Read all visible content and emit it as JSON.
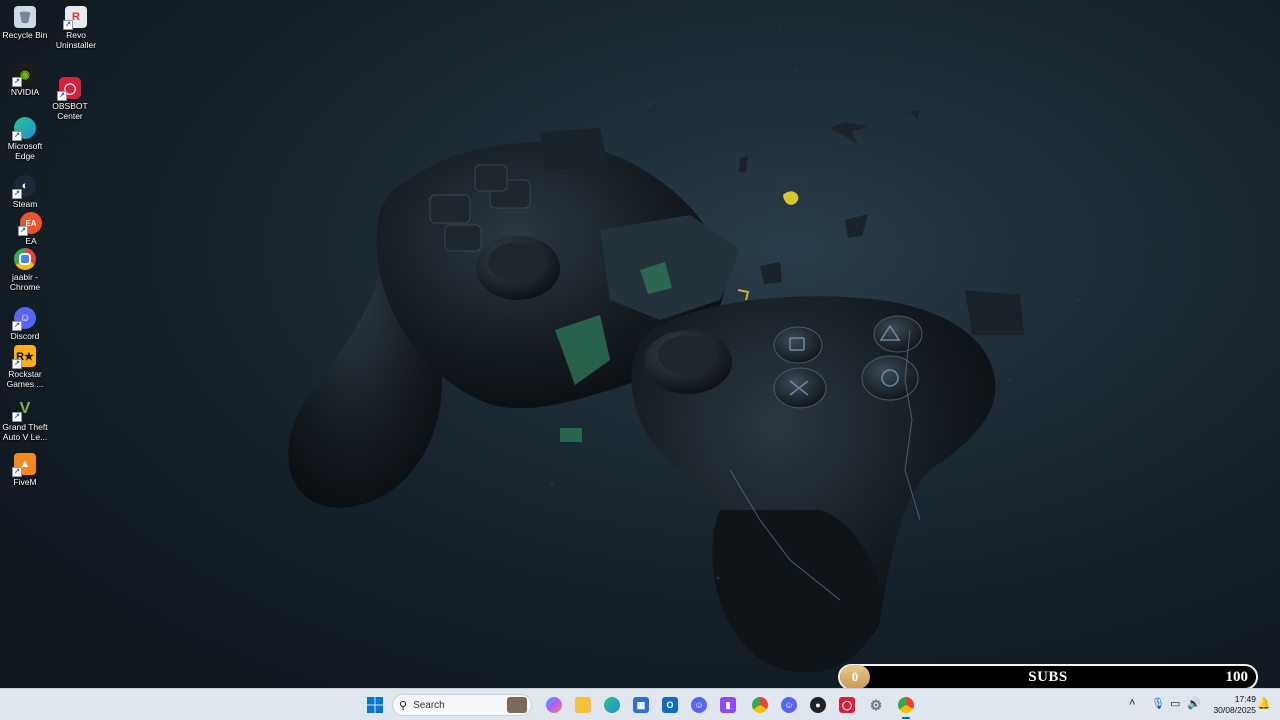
{
  "desktop_icons": [
    {
      "label": "Recycle Bin",
      "icon": "recycle-bin-icon",
      "color": "#cfd8e3"
    },
    {
      "label": "Revo Uninstaller",
      "icon": "revo-uninstaller-icon",
      "color": "#d33b2f"
    },
    {
      "label": "NVIDIA",
      "icon": "nvidia-icon",
      "color": "#76b900"
    },
    {
      "label": "OBSBOT Center",
      "icon": "obsbot-center-icon",
      "color": "#d6213a"
    },
    {
      "label": "Microsoft Edge",
      "icon": "edge-icon",
      "color": "#1fa2d6"
    },
    {
      "label": "Steam",
      "icon": "steam-icon",
      "color": "#1b2838"
    },
    {
      "label": "EA",
      "icon": "ea-icon",
      "color": "#f0522e"
    },
    {
      "label": "jaabir - Chrome",
      "icon": "chrome-icon",
      "color": "#fbbc04"
    },
    {
      "label": "Discord",
      "icon": "discord-icon",
      "color": "#5865f2"
    },
    {
      "label": "Rockstar Games ...",
      "icon": "rockstar-games-icon",
      "color": "#fcaf17"
    },
    {
      "label": "Grand Theft Auto V Le...",
      "icon": "gta-v-icon",
      "color": "#5b8a3a"
    },
    {
      "label": "FiveM",
      "icon": "fivem-icon",
      "color": "#f28a1e"
    }
  ],
  "subs_bar": {
    "current": "0",
    "label": "SUBS",
    "goal": "100",
    "progress": 0.0
  },
  "taskbar": {
    "search_placeholder": "Search",
    "pinned": [
      {
        "name": "copilot",
        "icon": "copilot-icon",
        "color": "#8a5cf6"
      },
      {
        "name": "file-explorer",
        "icon": "folder-icon",
        "color": "#f4c23d"
      },
      {
        "name": "edge",
        "icon": "edge-icon",
        "color": "#1fa2d6"
      },
      {
        "name": "microsoft-store",
        "icon": "store-icon",
        "color": "#2a6fd6"
      },
      {
        "name": "outlook",
        "icon": "outlook-icon",
        "color": "#0f6cbd"
      },
      {
        "name": "discord",
        "icon": "discord-icon",
        "color": "#5865f2"
      },
      {
        "name": "twitch",
        "icon": "twitch-icon",
        "color": "#9146ff"
      },
      {
        "name": "chrome",
        "icon": "chrome-icon",
        "color": "#34a853"
      },
      {
        "name": "discord-notify",
        "icon": "discord-icon",
        "color": "#5865f2"
      },
      {
        "name": "app-dark",
        "icon": "app-icon",
        "color": "#222222"
      },
      {
        "name": "obsbot",
        "icon": "obsbot-icon",
        "color": "#d6213a"
      },
      {
        "name": "settings",
        "icon": "gear-icon",
        "color": "#6b7785"
      },
      {
        "name": "chrome-active",
        "icon": "chrome-icon",
        "color": "#34a853"
      }
    ],
    "time": "17:49",
    "date": "30/08/2025"
  }
}
